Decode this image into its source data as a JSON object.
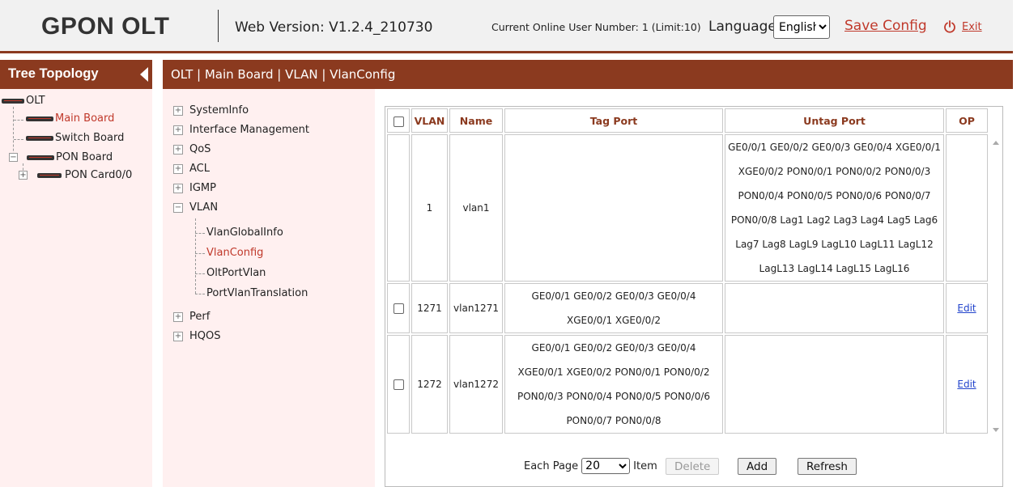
{
  "header": {
    "app_title": "GPON OLT",
    "web_version": "Web Version: V1.2.4_210730",
    "online_users": "Current Online User Number: 1 (Limit:10)",
    "language_label": "Language",
    "language_selected": "English",
    "save_config": "Save Config",
    "exit": "Exit"
  },
  "sidebar": {
    "title": "Tree Topology",
    "items": [
      {
        "label": "OLT"
      },
      {
        "label": "Main Board"
      },
      {
        "label": "Switch Board"
      },
      {
        "label": "PON Board"
      },
      {
        "label": "PON Card0/0"
      }
    ]
  },
  "breadcrumb": "OLT | Main Board | VLAN | VlanConfig",
  "menu": {
    "items": [
      "SystemInfo",
      "Interface Management",
      "QoS",
      "ACL",
      "IGMP",
      "VLAN",
      "Perf",
      "HQOS"
    ],
    "vlan_sub": [
      "VlanGlobalInfo",
      "VlanConfig",
      "OltPortVlan",
      "PortVlanTranslation"
    ]
  },
  "table": {
    "headers": [
      "VLAN",
      "Name",
      "Tag Port",
      "Untag Port",
      "OP"
    ],
    "rows": [
      {
        "vlan": "1",
        "name": "vlan1",
        "tag_port": "",
        "untag_port": "GE0/0/1 GE0/0/2 GE0/0/3 GE0/0/4 XGE0/0/1 XGE0/0/2 PON0/0/1 PON0/0/2 PON0/0/3 PON0/0/4 PON0/0/5 PON0/0/6 PON0/0/7 PON0/0/8 Lag1 Lag2 Lag3 Lag4 Lag5 Lag6 Lag7 Lag8 LagL9 LagL10 LagL11 LagL12 LagL13 LagL14 LagL15 LagL16",
        "op": ""
      },
      {
        "vlan": "1271",
        "name": "vlan1271",
        "tag_port": "GE0/0/1 GE0/0/2 GE0/0/3 GE0/0/4 XGE0/0/1 XGE0/0/2",
        "untag_port": "",
        "op": "Edit"
      },
      {
        "vlan": "1272",
        "name": "vlan1272",
        "tag_port": "GE0/0/1 GE0/0/2 GE0/0/3 GE0/0/4 XGE0/0/1 XGE0/0/2 PON0/0/1 PON0/0/2 PON0/0/3 PON0/0/4 PON0/0/5 PON0/0/6 PON0/0/7 PON0/0/8",
        "untag_port": "",
        "op": "Edit"
      }
    ]
  },
  "pager": {
    "each_page_label": "Each Page",
    "page_size": "20",
    "item_label": "Item",
    "delete_label": "Delete",
    "add_label": "Add",
    "refresh_label": "Refresh"
  },
  "colors": {
    "brand": "#8b3a1f",
    "accent_red": "#c0392b",
    "panel_bg": "#fff0f0",
    "link_blue": "#2244cc"
  }
}
